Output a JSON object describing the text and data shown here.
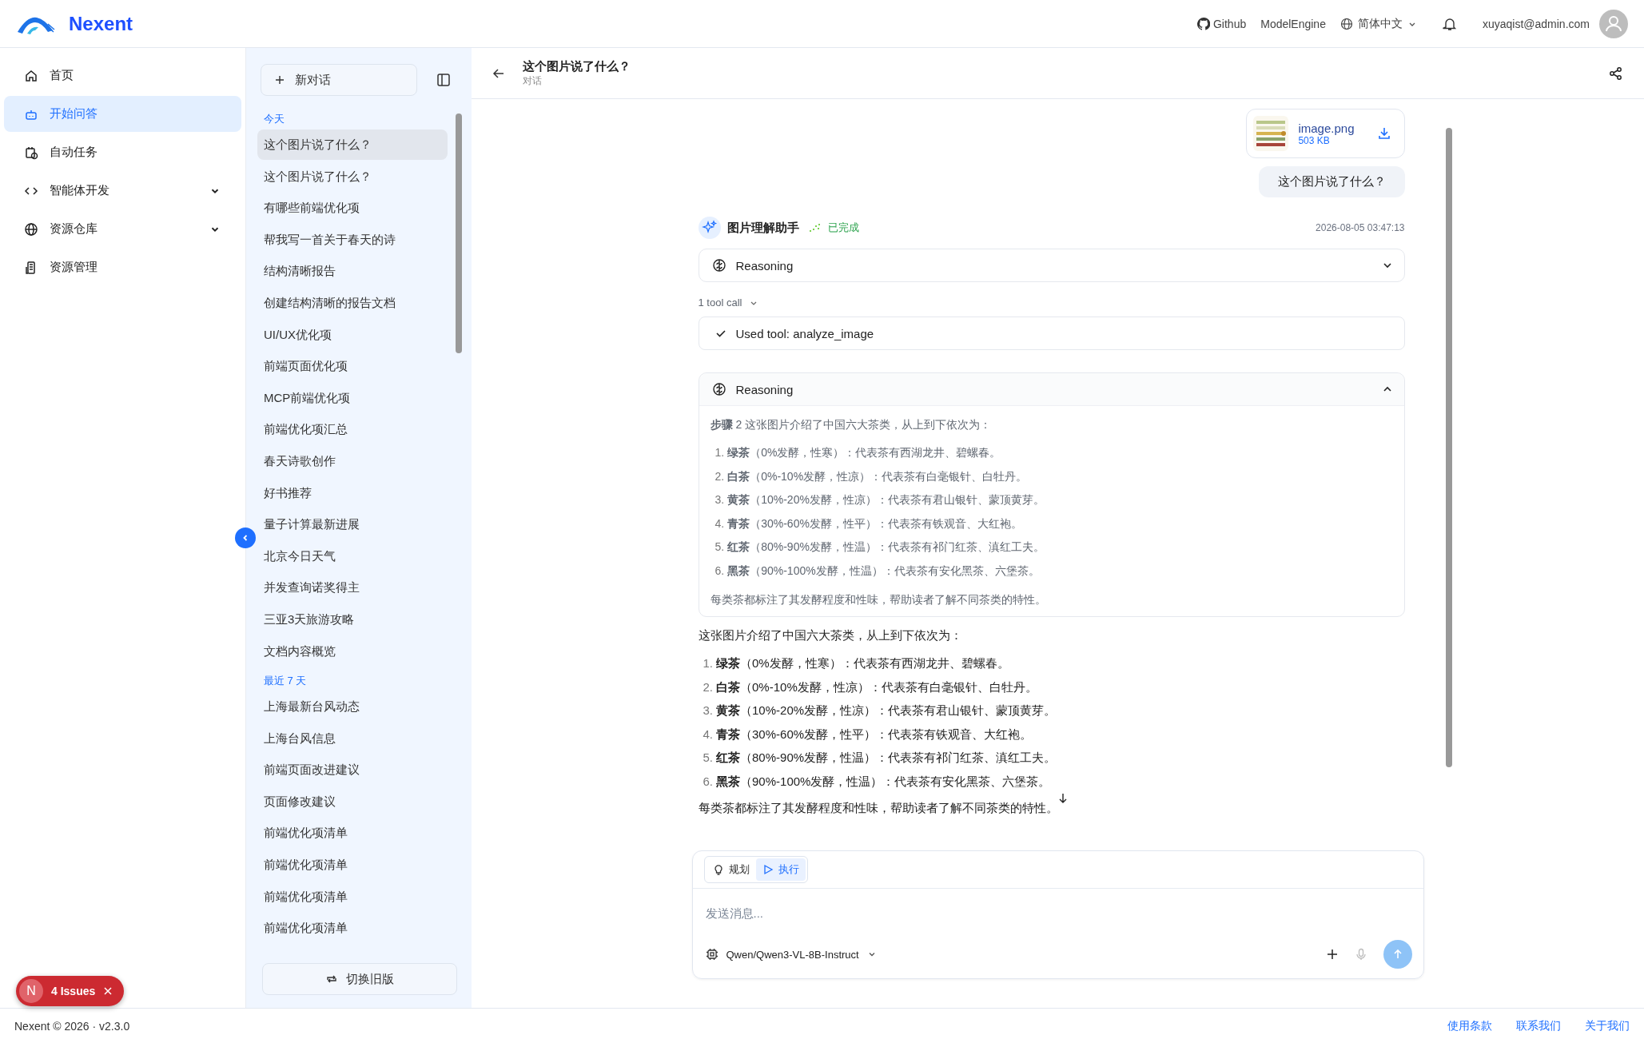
{
  "header": {
    "logo_text": "Nexent",
    "links": [
      "Github",
      "ModelEngine"
    ],
    "language": "简体中文",
    "user": "xuyaqist@admin.com"
  },
  "nav": [
    {
      "label": "首页",
      "kind": "link",
      "selected": false
    },
    {
      "label": "开始问答",
      "kind": "link",
      "selected": true
    },
    {
      "label": "自动任务",
      "kind": "link",
      "selected": false
    },
    {
      "label": "智能体开发",
      "kind": "group",
      "selected": false,
      "expanded": false
    },
    {
      "label": "资源仓库",
      "kind": "group",
      "selected": false,
      "expanded": false
    },
    {
      "label": "资源管理",
      "kind": "link",
      "selected": false
    }
  ],
  "conversations": {
    "new_button": "新对话",
    "groups": [
      {
        "label": "今天",
        "items": [
          {
            "title": "这个图片说了什么？",
            "selected": true
          },
          {
            "title": "这个图片说了什么？",
            "selected": false
          },
          {
            "title": "有哪些前端优化项",
            "selected": false
          },
          {
            "title": "帮我写一首关于春天的诗",
            "selected": false
          },
          {
            "title": "结构清晰报告",
            "selected": false
          },
          {
            "title": "创建结构清晰的报告文档",
            "selected": false
          },
          {
            "title": "UI/UX优化项",
            "selected": false
          },
          {
            "title": "前端页面优化项",
            "selected": false
          },
          {
            "title": "MCP前端优化项",
            "selected": false
          },
          {
            "title": "前端优化项汇总",
            "selected": false
          },
          {
            "title": "春天诗歌创作",
            "selected": false
          },
          {
            "title": "好书推荐",
            "selected": false
          },
          {
            "title": "量子计算最新进展",
            "selected": false
          },
          {
            "title": "北京今日天气",
            "selected": false
          },
          {
            "title": "并发查询诺奖得主",
            "selected": false
          },
          {
            "title": "三亚3天旅游攻略",
            "selected": false
          },
          {
            "title": "文档内容概览",
            "selected": false
          }
        ]
      },
      {
        "label": "最近 7 天",
        "items": [
          {
            "title": "上海最新台风动态",
            "selected": false
          },
          {
            "title": "上海台风信息",
            "selected": false
          },
          {
            "title": "前端页面改进建议",
            "selected": false
          },
          {
            "title": "页面修改建议",
            "selected": false
          },
          {
            "title": "前端优化项清单",
            "selected": false
          },
          {
            "title": "前端优化项清单",
            "selected": false
          },
          {
            "title": "前端优化项清单",
            "selected": false
          },
          {
            "title": "前端优化项清单",
            "selected": false
          }
        ]
      }
    ],
    "switch_button": "切换旧版"
  },
  "chat": {
    "title": "这个图片说了什么？",
    "subtitle": "对话",
    "attachment": {
      "name": "image.png",
      "size": "503 KB"
    },
    "user_message": "这个图片说了什么？",
    "assistant": {
      "name": "图片理解助手",
      "status": "已完成",
      "time": "2026-08-05 03:47:13"
    },
    "blocks": [
      {
        "kind": "reasoning",
        "title": "Reasoning",
        "expanded": false
      },
      {
        "kind": "tool_call",
        "count_label": "1 tool call",
        "label": "Used tool: analyze_image"
      },
      {
        "kind": "reasoning",
        "title": "Reasoning",
        "expanded": true,
        "lead": "**步骤** 2 这张图片介绍了中国六大茶类，从上到下依次为：",
        "items": [
          {
            "number": "1.",
            "text": "**绿茶**（0%发酵，性寒）：代表茶有西湖龙井、碧螺春。"
          },
          {
            "number": "2.",
            "text": "**白茶**（0%-10%发酵，性凉）：代表茶有白毫银针、白牡丹。"
          },
          {
            "number": "3.",
            "text": "**黄茶**（10%-20%发酵，性凉）：代表茶有君山银针、蒙顶黄芽。"
          },
          {
            "number": "4.",
            "text": "**青茶**（30%-60%发酵，性平）：代表茶有铁观音、大红袍。"
          },
          {
            "number": "5.",
            "text": "**红茶**（80%-90%发酵，性温）：代表茶有祁门红茶、滇红工夫。"
          },
          {
            "number": "6.",
            "text": "**黑茶**（90%-100%发酵，性温）：代表茶有安化黑茶、六堡茶。"
          }
        ],
        "note": "每类茶都标注了其发酵程度和性味，帮助读者了解不同茶类的特性。"
      }
    ],
    "answer": {
      "intro": "这张图片介绍了中国六大茶类，从上到下依次为：",
      "items": [
        {
          "number": "1.",
          "text": "**绿茶**（0%发酵，性寒）：代表茶有西湖龙井、碧螺春。"
        },
        {
          "number": "2.",
          "text": "**白茶**（0%-10%发酵，性凉）：代表茶有白毫银针、白牡丹。"
        },
        {
          "number": "3.",
          "text": "**黄茶**（10%-20%发酵，性凉）：代表茶有君山银针、蒙顶黄芽。"
        },
        {
          "number": "4.",
          "text": "**青茶**（30%-60%发酵，性平）：代表茶有铁观音、大红袍。"
        },
        {
          "number": "5.",
          "text": "**红茶**（80%-90%发酵，性温）：代表茶有祁门红茶、滇红工夫。"
        },
        {
          "number": "6.",
          "text": "**黑茶**（90%-100%发酵，性温）：代表茶有安化黑茶、六堡茶。"
        }
      ],
      "outro": "每类茶都标注了其发酵程度和性味，帮助读者了解不同茶类的特性。"
    },
    "input": {
      "modes": [
        {
          "label": "规划",
          "selected": false
        },
        {
          "label": "执行",
          "selected": true
        }
      ],
      "placeholder": "发送消息...",
      "model": "Qwen/Qwen3-VL-8B-Instruct"
    }
  },
  "footer": {
    "copyright": "Nexent © 2026 · v2.3.0",
    "links": [
      "使用条款",
      "联系我们",
      "关于我们"
    ]
  },
  "issues_badge": {
    "initial": "N",
    "label": "4 Issues"
  }
}
